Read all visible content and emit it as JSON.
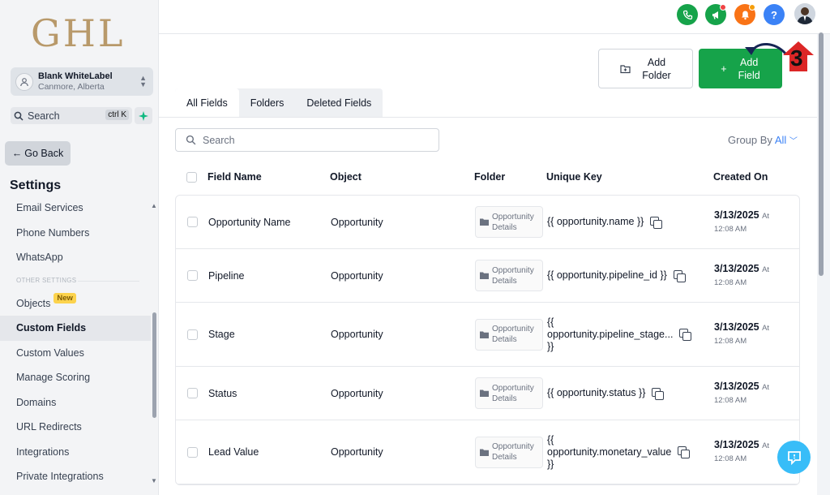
{
  "sidebar": {
    "logo": "GHL",
    "account": {
      "name": "Blank WhiteLabel",
      "location": "Canmore, Alberta"
    },
    "search": {
      "placeholder": "Search",
      "shortcut": "ctrl K"
    },
    "go_back": "Go Back",
    "title": "Settings",
    "items": [
      {
        "label": "Email Services"
      },
      {
        "label": "Phone Numbers"
      },
      {
        "label": "WhatsApp"
      }
    ],
    "group_label": "OTHER SETTINGS",
    "other_items": [
      {
        "label": "Objects",
        "badge": "New"
      },
      {
        "label": "Custom Fields",
        "active": true
      },
      {
        "label": "Custom Values"
      },
      {
        "label": "Manage Scoring"
      },
      {
        "label": "Domains"
      },
      {
        "label": "URL Redirects"
      },
      {
        "label": "Integrations"
      },
      {
        "label": "Private Integrations"
      }
    ]
  },
  "topbar": {
    "icons": [
      "phone-icon",
      "megaphone-icon",
      "bell-icon",
      "help-icon"
    ],
    "colors": {
      "phone": "#16a34a",
      "megaphone": "#16a34a",
      "bell": "#f97316",
      "help": "#3b82f6"
    }
  },
  "actions": {
    "add_folder": [
      "Add",
      "Folder"
    ],
    "add_field": [
      "Add",
      "Field"
    ]
  },
  "annotation": {
    "step": "3"
  },
  "tabs": [
    "All Fields",
    "Folders",
    "Deleted Fields"
  ],
  "search": {
    "placeholder": "Search"
  },
  "group_by": {
    "label": "Group By",
    "value": "All"
  },
  "table": {
    "headers": [
      "Field Name",
      "Object",
      "Folder",
      "Unique Key",
      "Created On"
    ],
    "rows": [
      {
        "name": "Opportunity Name",
        "object": "Opportunity",
        "folder": [
          "Opportunity",
          "Details"
        ],
        "key": "{{ opportunity.name }}",
        "date": "3/13/2025",
        "at": "At",
        "time": "12:08 AM"
      },
      {
        "name": "Pipeline",
        "object": "Opportunity",
        "folder": [
          "Opportunity",
          "Details"
        ],
        "key": "{{ opportunity.pipeline_id }}",
        "date": "3/13/2025",
        "at": "At",
        "time": "12:08 AM"
      },
      {
        "name": "Stage",
        "object": "Opportunity",
        "folder": [
          "Opportunity",
          "Details"
        ],
        "key_lines": [
          "{{",
          "opportunity.pipeline_stage...",
          "}}"
        ],
        "date": "3/13/2025",
        "at": "At",
        "time": "12:08 AM"
      },
      {
        "name": "Status",
        "object": "Opportunity",
        "folder": [
          "Opportunity",
          "Details"
        ],
        "key": "{{ opportunity.status }}",
        "date": "3/13/2025",
        "at": "At",
        "time": "12:08 AM"
      },
      {
        "name": "Lead Value",
        "object": "Opportunity",
        "folder": [
          "Opportunity",
          "Details"
        ],
        "key_lines": [
          "{{",
          "opportunity.monetary_value",
          "}}"
        ],
        "date": "3/13/2025",
        "at": "At",
        "time": "12:08 AM"
      }
    ]
  }
}
